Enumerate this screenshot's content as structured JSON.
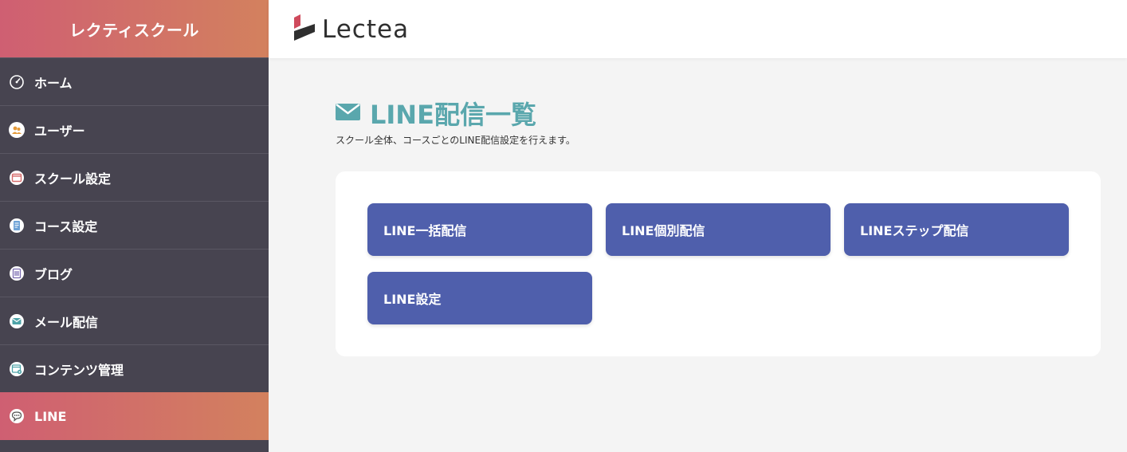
{
  "sidebar": {
    "school_name": "レクティスクール",
    "items": [
      {
        "label": "ホーム",
        "icon": "dashboard-icon",
        "active": false
      },
      {
        "label": "ユーザー",
        "icon": "users-icon",
        "active": false
      },
      {
        "label": "スクール設定",
        "icon": "window-icon",
        "active": false
      },
      {
        "label": "コース設定",
        "icon": "document-icon",
        "active": false
      },
      {
        "label": "ブログ",
        "icon": "blog-icon",
        "active": false
      },
      {
        "label": "メール配信",
        "icon": "mail-icon",
        "active": false
      },
      {
        "label": "コンテンツ管理",
        "icon": "content-icon",
        "active": false
      },
      {
        "label": "LINE",
        "icon": "chat-icon",
        "active": true
      }
    ]
  },
  "header": {
    "logo_text": "Lectea"
  },
  "main": {
    "title": "LINE配信一覧",
    "description": "スクール全体、コースごとのLINE配信設定を行えます。",
    "buttons": [
      {
        "label": "LINE一括配信"
      },
      {
        "label": "LINE個別配信"
      },
      {
        "label": "LINEステップ配信"
      },
      {
        "label": "LINE設定"
      }
    ]
  },
  "colors": {
    "sidebar_bg": "#474450",
    "accent_gradient_start": "#cf5f72",
    "accent_gradient_end": "#d3815e",
    "title_color": "#5aa7ad",
    "button_bg": "#4f5fac",
    "page_bg": "#f4f4f4"
  }
}
